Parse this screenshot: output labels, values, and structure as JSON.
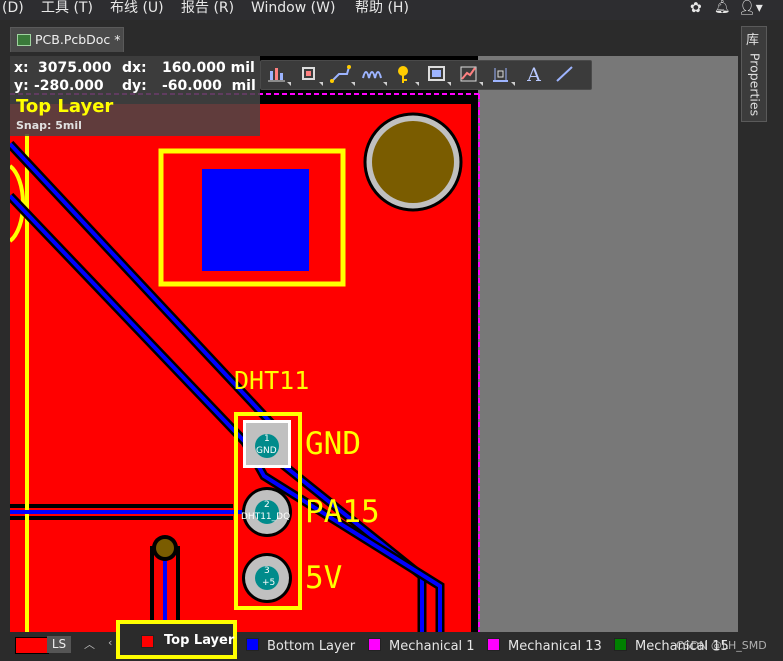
{
  "menu": {
    "items": [
      "(D)",
      "工具 (T)",
      "布线 (U)",
      "报告 (R)",
      "Window (W)",
      "帮助 (H)"
    ]
  },
  "tab": {
    "title": "PCB.PcbDoc *"
  },
  "right_panel": {
    "tab_label": "Properties",
    "glyph": "库"
  },
  "hud": {
    "x_label": "x:",
    "x_value": "3075.000",
    "dx_label": "dx:",
    "dx_value": "160.000 mil",
    "y_label": "y:",
    "y_value": "-280.000",
    "dy_label": "dy:",
    "dy_value": "-60.000  mil",
    "layer": "Top Layer",
    "snap": "Snap: 5mil"
  },
  "toolbar": {
    "icons": [
      "bar-chart-icon",
      "component-icon",
      "route-icon",
      "wave-icon",
      "pin-icon",
      "rectangle-icon",
      "graph-icon",
      "measure-icon",
      "text-icon",
      "line-icon"
    ],
    "text_tool_label": "A"
  },
  "pcb": {
    "component_label": "DHT11",
    "pins": [
      {
        "number": "1",
        "net": "GND",
        "label": "GND"
      },
      {
        "number": "2",
        "net": "DHT11_DQ",
        "label": "PA15"
      },
      {
        "number": "3",
        "net": "+5",
        "label": "5V"
      }
    ]
  },
  "statusbar": {
    "ls_label": "LS",
    "layers": [
      {
        "name": "Top Layer",
        "color": "#ff0000",
        "active": true
      },
      {
        "name": "Bottom Layer",
        "color": "#0000ff",
        "active": false
      },
      {
        "name": "Mechanical 1",
        "color": "#ff00ff",
        "active": false
      },
      {
        "name": "Mechanical 13",
        "color": "#ff00ff",
        "active": false
      },
      {
        "name": "Mechanical 15",
        "color": "#008000",
        "active": false
      }
    ],
    "watermark": "CSDN @LH_SMD"
  },
  "colors": {
    "top_layer": "#ff0000",
    "bottom_layer": "#0000ff",
    "silkscreen": "#ffff00",
    "mechanical": "#ff00ff",
    "pad": "#c0c0c0",
    "via": "#7a5c00"
  }
}
